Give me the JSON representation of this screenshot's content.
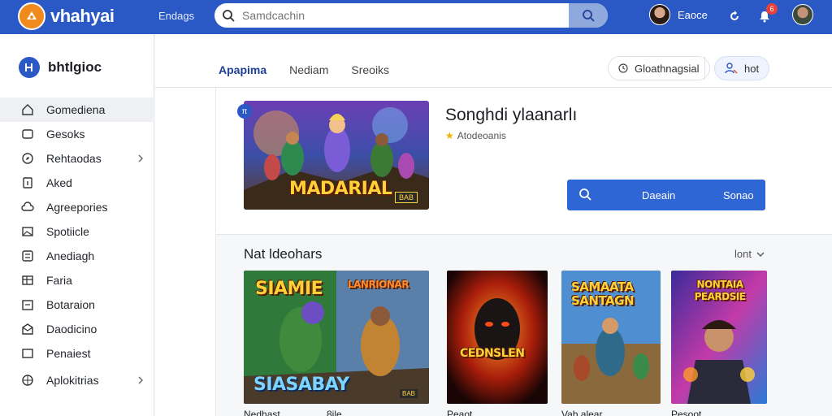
{
  "app": {
    "logo_text": "vhahyai",
    "top_link": "Endags"
  },
  "search": {
    "placeholder": "Samdcachin",
    "value": ""
  },
  "user": {
    "name": "Eaoce",
    "notification_count": "6"
  },
  "sidebar": {
    "brand": "bhtlgioc",
    "items": [
      {
        "label": "Gomediena",
        "icon": "home-icon",
        "active": true
      },
      {
        "label": "Gesoks",
        "icon": "square-icon"
      },
      {
        "label": "Rehtaodas",
        "icon": "compass-icon",
        "has_children": true
      },
      {
        "label": "Aked",
        "icon": "info-icon"
      },
      {
        "label": "Agreepories",
        "icon": "cloud-icon"
      },
      {
        "label": "Spotiicle",
        "icon": "image-icon"
      },
      {
        "label": "Anediagh",
        "icon": "grid-icon"
      },
      {
        "label": "Faria",
        "icon": "table-icon"
      },
      {
        "label": "Botaraion",
        "icon": "calendar-icon"
      },
      {
        "label": "Daodicino",
        "icon": "mail-icon"
      },
      {
        "label": "Penaiest",
        "icon": "square-icon"
      },
      {
        "label": "Aplokitrias",
        "icon": "globe-icon",
        "has_children": true
      }
    ]
  },
  "tabs": [
    {
      "label": "Apapima",
      "active": true
    },
    {
      "label": "Nediam"
    },
    {
      "label": "Sreoiks"
    }
  ],
  "actions": {
    "filter_label": "Gloathnagsial",
    "profile_label": "hot"
  },
  "featured": {
    "title": "Songhdi ylaanarlı",
    "subtitle": "Atodeoanis",
    "art_title": "MADARIAL",
    "art_tag": "BAB",
    "cta_left": "Daeain",
    "cta_right": "Sonao"
  },
  "section": {
    "title": "Nat ldeohars",
    "sort_label": "lont",
    "cards": [
      {
        "label": "Nedhast",
        "art_title_top": "SIAMIE",
        "art_title_bottom": "SIASABAY",
        "meta": "BAB"
      },
      {
        "label": "8ile",
        "art_title_top": "LANRIONAR",
        "meta": ""
      },
      {
        "label": "Peaot",
        "art_title_top": "CEDNSLEN",
        "meta": ""
      },
      {
        "label": "Vab alear",
        "art_title_top": "SAMAATA SANTAGN",
        "meta": ""
      },
      {
        "label": "Pesoot",
        "art_title_top": "NONTAIA PEARDSIE",
        "meta": ""
      }
    ]
  },
  "colors": {
    "brand_blue": "#2a58c4",
    "accent_orange": "#f08a1c",
    "badge_red": "#e8413b",
    "cta_blue": "#2f66d6"
  }
}
